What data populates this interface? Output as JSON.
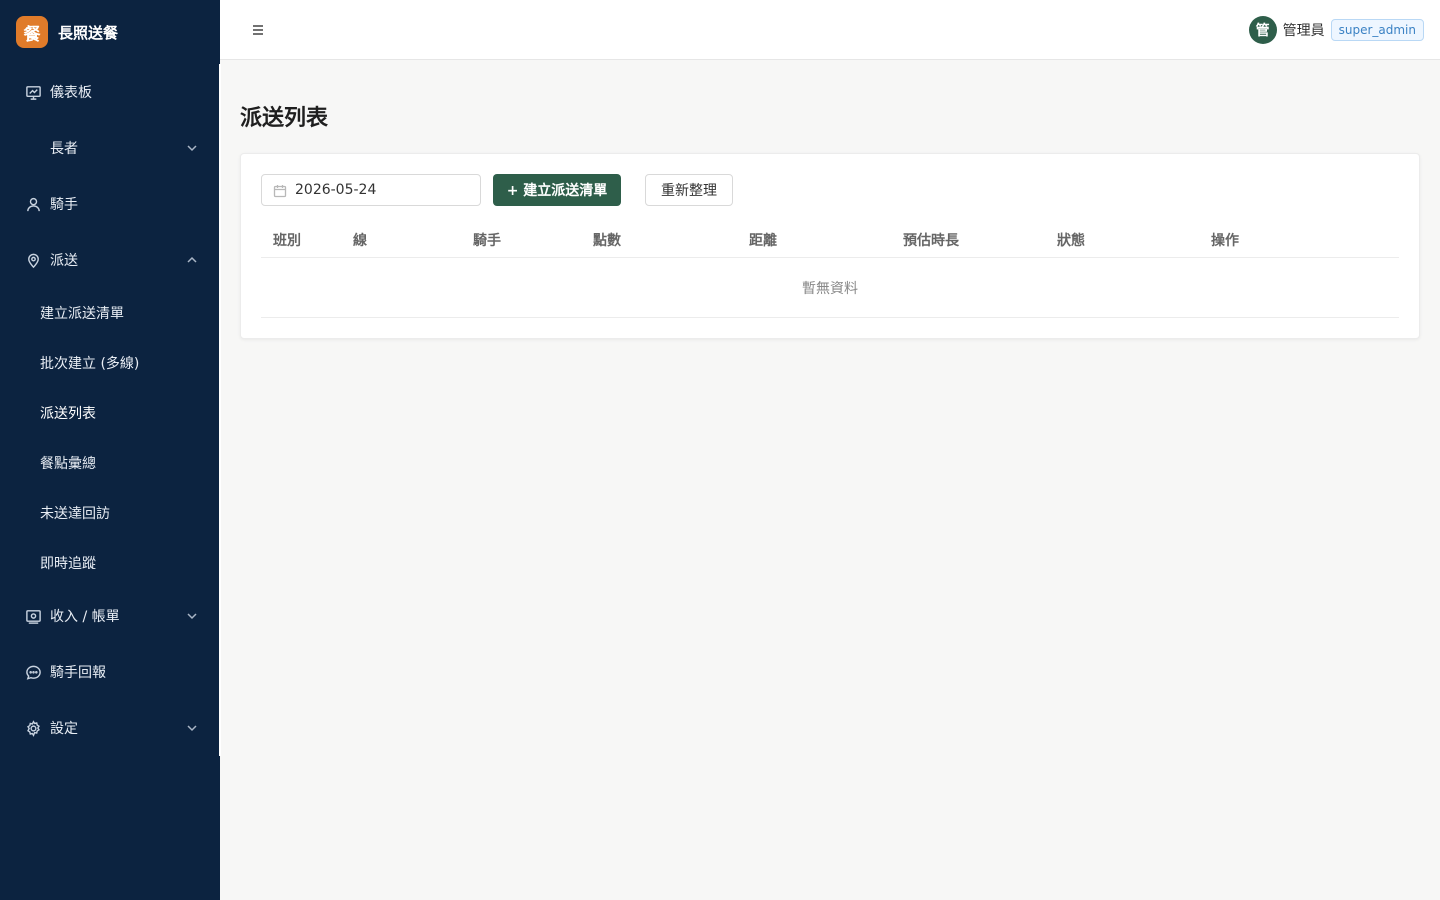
{
  "brand": {
    "logo_char": "餐",
    "name": "長照送餐"
  },
  "sidebar": {
    "items": [
      {
        "label": "儀表板",
        "icon": "dashboard-icon"
      },
      {
        "label": "長者"
      },
      {
        "label": "騎手",
        "icon": "user-icon"
      },
      {
        "label": "派送",
        "icon": "location-icon",
        "expanded": true
      },
      {
        "label": "收入 / 帳單",
        "icon": "wallet-icon"
      },
      {
        "label": "騎手回報",
        "icon": "chat-icon"
      },
      {
        "label": "設定",
        "icon": "gear-icon"
      }
    ],
    "dispatch_sub": [
      {
        "label": "建立派送清單"
      },
      {
        "label": "批次建立 (多線)"
      },
      {
        "label": "派送列表",
        "active": true
      },
      {
        "label": "餐點彙總"
      },
      {
        "label": "未送達回訪"
      },
      {
        "label": "即時追蹤"
      }
    ]
  },
  "header": {
    "avatar_char": "管",
    "user_name": "管理員",
    "role": "super_admin"
  },
  "page": {
    "title": "派送列表",
    "date_value": "2026-05-24",
    "create_button": "+ 建立派送清單",
    "refresh_button": "重新整理"
  },
  "table": {
    "columns": [
      "班別",
      "線",
      "騎手",
      "點數",
      "距離",
      "預估時長",
      "狀態",
      "操作"
    ],
    "rows": [],
    "empty_text": "暫無資料"
  },
  "colors": {
    "sidebar_bg": "#0c2340",
    "primary": "#2e5e4a",
    "brand_logo": "#e07b2a",
    "role_tag_text": "#3b82c4"
  }
}
